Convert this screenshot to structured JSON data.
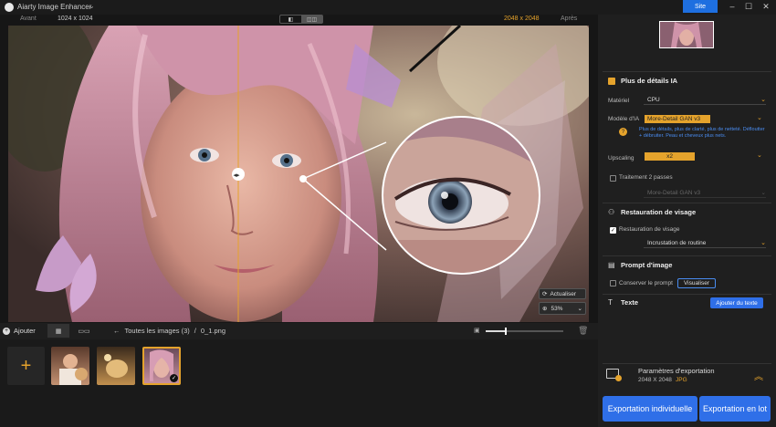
{
  "app": {
    "title": "Aiarty Image Enhancer",
    "site_button": "Site"
  },
  "viewbar": {
    "before_label": "Avant",
    "before_size": "1024 x 1024",
    "after_size": "2048 x 2048",
    "after_label": "Après"
  },
  "canvas": {
    "refresh_label": "Actualiser",
    "zoom_value": "53%"
  },
  "bottombar": {
    "add_label": "Ajouter",
    "breadcrumb_root": "Toutes les images (3)",
    "breadcrumb_sep": "/",
    "breadcrumb_file": "0_1.png"
  },
  "sidebar": {
    "section_ai": "Plus de détails IA",
    "hardware_label": "Matériel",
    "hardware_value": "CPU",
    "model_label": "Modèle d'IA",
    "model_value": "More-Detail GAN  v3",
    "model_desc": "Plus de détails, plus de clarté, plus de netteté. Défloutter + débruiter. Peau et cheveux plus nets.",
    "upscaling_label": "Upscaling",
    "upscaling_value": "x2",
    "two_pass_label": "Traitement 2 passes",
    "two_pass_model": "More-Detail GAN  v3",
    "section_face": "Restauration de visage",
    "face_toggle_label": "Restauration de visage",
    "face_mode": "Incrustation de routine",
    "section_prompt": "Prompt d'image",
    "keep_prompt_label": "Conserver le prompt",
    "visualize_button": "Visualiser",
    "section_text": "Texte",
    "add_text_button": "Ajouter du texte",
    "export_settings_title": "Paramètres d'exportation",
    "export_size": "2048 X 2048",
    "export_format": "JPG",
    "export_one_button": "Exportation individuelle",
    "export_batch_button": "Exportation en lot"
  },
  "colors": {
    "accent": "#e5a32c",
    "primary": "#2f6fe8",
    "background": "#161616"
  },
  "icons": [
    "logo-icon",
    "chevron-down-icon",
    "minimize-icon",
    "maximize-icon",
    "close-icon",
    "split-view-icon",
    "refresh-icon",
    "zoom-icon",
    "plus-icon",
    "grid-icon",
    "list-icon",
    "back-arrow-icon",
    "image-icon",
    "trash-icon",
    "help-icon",
    "export-settings-icon",
    "chevron-up-icon",
    "checkmark-icon"
  ]
}
